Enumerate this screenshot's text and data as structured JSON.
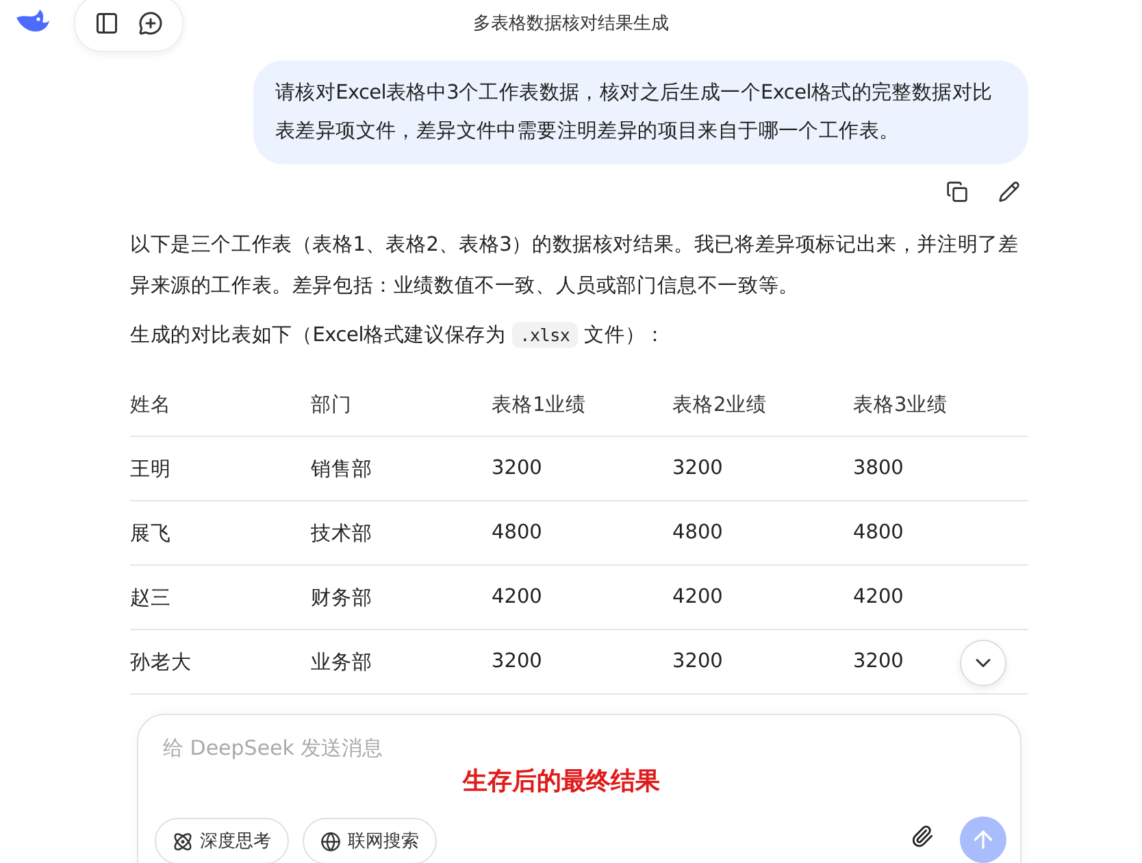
{
  "header": {
    "title": "多表格数据核对结果生成"
  },
  "user_message": {
    "text": "请核对Excel表格中3个工作表数据，核对之后生成一个Excel格式的完整数据对比表差异项文件，差异文件中需要注明差异的项目来自于哪一个工作表。"
  },
  "reply": {
    "paragraphs": [
      {
        "parts": [
          {
            "kind": "text",
            "text": "以下是三个工作表（表格1、表格2、表格3）的数据核对结果。我已将差异项标记出来，并注明了差异来源的工作表。差异包括：业绩数值不一致、人员或部门信息不一致等。"
          }
        ]
      },
      {
        "parts": [
          {
            "kind": "text",
            "text": "生成的对比表如下（Excel格式建议保存为 "
          },
          {
            "kind": "code",
            "text": ".xlsx"
          },
          {
            "kind": "text",
            "text": " 文件）："
          }
        ]
      }
    ],
    "table": {
      "columns": [
        "姓名",
        "部门",
        "表格1业绩",
        "表格2业绩",
        "表格3业绩"
      ],
      "rows": [
        [
          "王明",
          "销售部",
          "3200",
          "3200",
          "3800"
        ],
        [
          "展飞",
          "技术部",
          "4800",
          "4800",
          "4800"
        ],
        [
          "赵三",
          "财务部",
          "4200",
          "4200",
          "4200"
        ],
        [
          "孙老大",
          "业务部",
          "3200",
          "3200",
          "3200"
        ]
      ]
    }
  },
  "composer": {
    "placeholder": "给 DeepSeek 发送消息",
    "annotation": "生存后的最终结果",
    "toggles": [
      {
        "kind": "think",
        "label": "深度思考",
        "selected": false
      },
      {
        "kind": "search",
        "label": "联网搜索",
        "selected": false
      }
    ],
    "send_disabled": true
  }
}
